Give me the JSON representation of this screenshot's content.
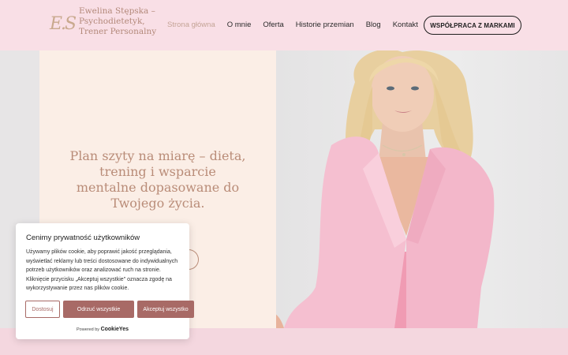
{
  "header": {
    "logo_mark": "E.S",
    "brand_name": "Ewelina Stępska – Psychodietetyk, Trener Personalny",
    "nav": [
      {
        "label": "Strona główna",
        "active": true
      },
      {
        "label": "O mnie",
        "active": false
      },
      {
        "label": "Oferta",
        "active": false
      },
      {
        "label": "Historie przemian",
        "active": false
      },
      {
        "label": "Blog",
        "active": false
      },
      {
        "label": "Kontakt",
        "active": false
      }
    ],
    "cta_label": "WSPÓŁPRACA Z MARKAMI"
  },
  "hero": {
    "headline": "Plan szyty na miarę – dieta, trening i wsparcie mentalne dopasowane do Twojego życia."
  },
  "cookie": {
    "title": "Cenimy prywatność użytkowników",
    "text": "Używamy plików cookie, aby poprawić jakość przeglądania, wyświetlać reklamy lub treści dostosowane do indywidualnych potrzeb użytkowników oraz analizować ruch na stronie. Kliknięcie przycisku „Akceptuj wszystkie\" oznacza zgodę na wykorzystywanie przez nas plików cookie.",
    "customize_label": "Dostosuj",
    "reject_label": "Odrzuć wszystkie",
    "accept_label": "Akceptuj wszystko",
    "powered_prefix": "Powered by",
    "powered_brand": "CookieYes"
  },
  "colors": {
    "accent": "#a86a66",
    "header_bg": "#f9dfe6",
    "headline": "#b98c78"
  }
}
